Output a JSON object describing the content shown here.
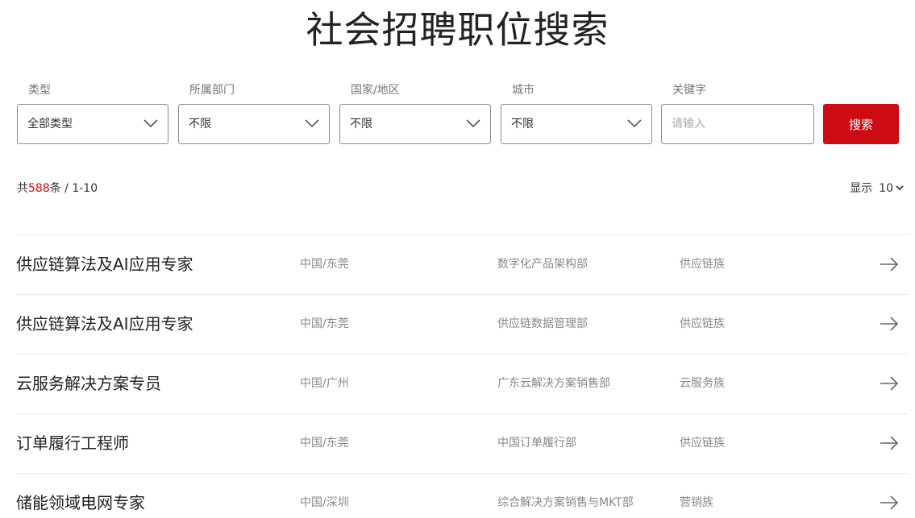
{
  "page": {
    "title": "社会招聘职位搜索"
  },
  "filters": {
    "type": {
      "label": "类型",
      "value": "全部类型"
    },
    "department": {
      "label": "所属部门",
      "value": "不限"
    },
    "country": {
      "label": "国家/地区",
      "value": "不限"
    },
    "city": {
      "label": "城市",
      "value": "不限"
    },
    "keyword": {
      "label": "关键字",
      "value": "",
      "placeholder": "请输入"
    },
    "search_label": "搜索"
  },
  "results": {
    "prefix": "共",
    "total": "588",
    "suffix": "条 / 1-10",
    "page_size_label": "显示",
    "page_size": "10"
  },
  "jobs": [
    {
      "title": "供应链算法及AI应用专家",
      "location": "中国/东莞",
      "department": "数字化产品架构部",
      "family": "供应链族"
    },
    {
      "title": "供应链算法及AI应用专家",
      "location": "中国/东莞",
      "department": "供应链数据管理部",
      "family": "供应链族"
    },
    {
      "title": "云服务解决方案专员",
      "location": "中国/广州",
      "department": "广东云解决方案销售部",
      "family": "云服务族"
    },
    {
      "title": "订单履行工程师",
      "location": "中国/东莞",
      "department": "中国订单履行部",
      "family": "供应链族"
    },
    {
      "title": "储能领域电网专家",
      "location": "中国/深圳",
      "department": "综合解决方案销售与MKT部",
      "family": "营销族"
    }
  ],
  "colors": {
    "accent": "#cc0b12",
    "border": "#8a8a8a",
    "divider": "#e8e8e8",
    "muted_text": "#888888"
  },
  "icons": {
    "select_chevron": "chevron-down-icon",
    "page_size_chevron": "chevron-down-icon",
    "row_arrow": "arrow-right-icon"
  }
}
